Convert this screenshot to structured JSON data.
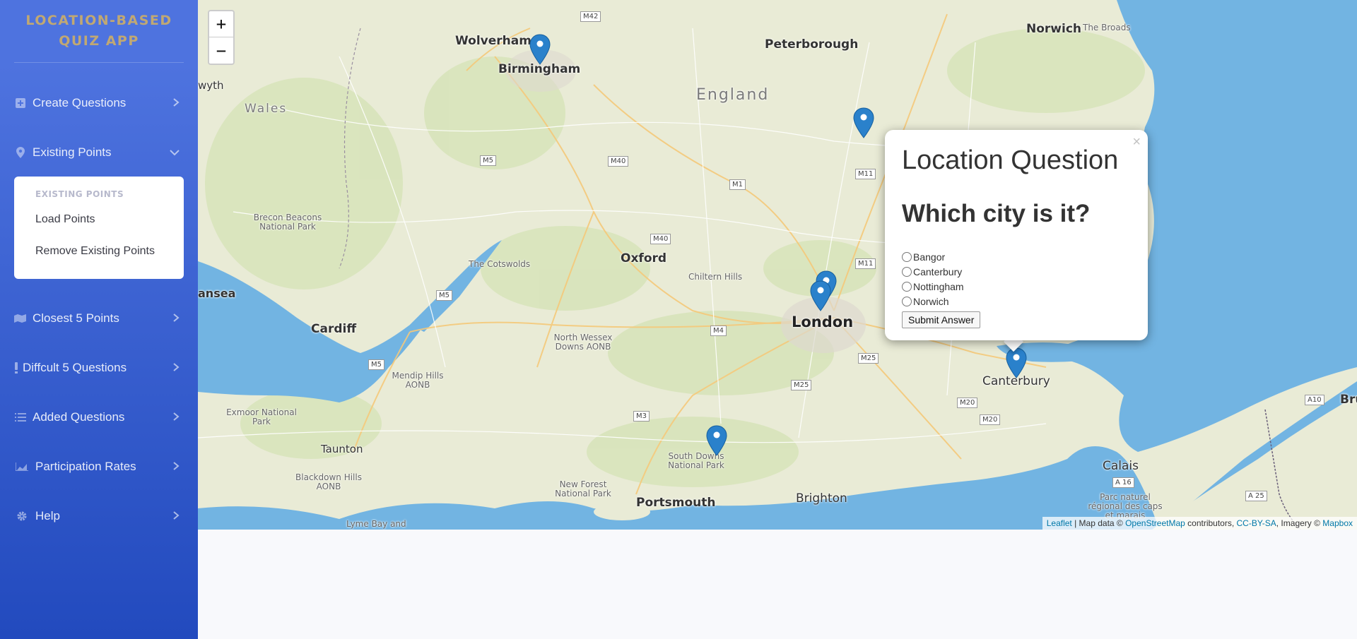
{
  "sidebar": {
    "brand": "LOCATION-BASED QUIZ APP",
    "items": [
      {
        "label": "Create Questions",
        "icon": "plus-square-icon",
        "expanded": false
      },
      {
        "label": "Existing Points",
        "icon": "map-marker-icon",
        "expanded": true
      },
      {
        "label": "Closest 5 Points",
        "icon": "map-icon",
        "expanded": false
      },
      {
        "label": "Diffcult 5 Questions",
        "icon": "exclamation-icon",
        "expanded": false
      },
      {
        "label": "Added Questions",
        "icon": "list-icon",
        "expanded": false
      },
      {
        "label": "Participation Rates",
        "icon": "area-chart-icon",
        "expanded": false
      },
      {
        "label": "Help",
        "icon": "gear-icon",
        "expanded": false
      }
    ],
    "submenu": {
      "header": "EXISTING POINTS",
      "links": [
        "Load Points",
        "Remove Existing Points"
      ]
    }
  },
  "map": {
    "zoom_in": "+",
    "zoom_out": "−",
    "places": [
      {
        "name": "Wolverhampt",
        "kind": "city"
      },
      {
        "name": "Birmingham",
        "kind": "city"
      },
      {
        "name": "Peterborough",
        "kind": "city"
      },
      {
        "name": "Norwich",
        "kind": "city"
      },
      {
        "name": "The Broads",
        "kind": "park"
      },
      {
        "name": "England",
        "kind": "region"
      },
      {
        "name": "Wales",
        "kind": "region"
      },
      {
        "name": "wyth",
        "kind": "city"
      },
      {
        "name": "Brecon Beacons National Park",
        "kind": "park"
      },
      {
        "name": "The Cotswolds",
        "kind": "park"
      },
      {
        "name": "Oxford",
        "kind": "city"
      },
      {
        "name": "Chiltern Hills",
        "kind": "park"
      },
      {
        "name": "London",
        "kind": "big"
      },
      {
        "name": "ansea",
        "kind": "city"
      },
      {
        "name": "Cardiff",
        "kind": "city"
      },
      {
        "name": "North Wessex Downs AONB",
        "kind": "park"
      },
      {
        "name": "Mendip Hills AONB",
        "kind": "park"
      },
      {
        "name": "Exmoor National Park",
        "kind": "park"
      },
      {
        "name": "Taunton",
        "kind": "city"
      },
      {
        "name": "Blackdown Hills AONB",
        "kind": "park"
      },
      {
        "name": "South Downs National Park",
        "kind": "park"
      },
      {
        "name": "New Forest National Park",
        "kind": "park"
      },
      {
        "name": "Portsmouth",
        "kind": "city"
      },
      {
        "name": "Brighton",
        "kind": "city"
      },
      {
        "name": "Canterbury",
        "kind": "city"
      },
      {
        "name": "Calais",
        "kind": "city"
      },
      {
        "name": "Parc naturel régional des caps et marais",
        "kind": "park"
      },
      {
        "name": "Lyme Bay and",
        "kind": "park"
      },
      {
        "name": "Bru",
        "kind": "city"
      }
    ],
    "roads": [
      "M42",
      "M5",
      "M40",
      "M1",
      "M11",
      "M40",
      "M11",
      "M5",
      "M4",
      "M25",
      "M25",
      "M5",
      "M3",
      "M20",
      "M20",
      "A10",
      "A 16",
      "A 25"
    ],
    "attribution": {
      "leaflet": "Leaflet",
      "sep1": " | Map data © ",
      "osm": "OpenStreetMap",
      "sep2": " contributors, ",
      "license": "CC-BY-SA",
      "sep3": ", Imagery © ",
      "mapbox": "Mapbox"
    }
  },
  "popup": {
    "close": "×",
    "title": "Location Question",
    "question": "Which city is it?",
    "options": [
      "Bangor",
      "Canterbury",
      "Nottingham",
      "Norwich"
    ],
    "submit": "Submit Answer"
  },
  "colors": {
    "sidebar_top": "#4e73df",
    "sidebar_bottom": "#224abe",
    "sea": "#72b4e2",
    "land": "#e9ebd6",
    "marker": "#2a81cb"
  }
}
